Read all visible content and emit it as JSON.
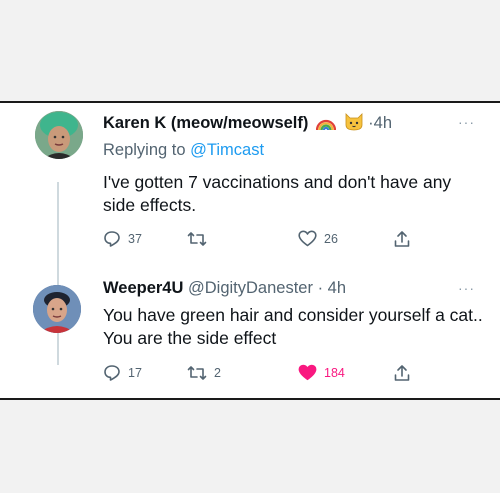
{
  "tweets": [
    {
      "author_name": "Karen K (meow/meowself)",
      "separator": "·",
      "time": "4h",
      "more": "···",
      "replying_prefix": "Replying to",
      "replying_handle": "@Timcast",
      "text": "I've gotten 7 vaccinations and don't have any side effects.",
      "stats": {
        "replies": "37",
        "retweets": "",
        "likes": "26"
      },
      "liked": false,
      "emojis": [
        "rainbow-icon",
        "cat-face-icon"
      ]
    },
    {
      "author_name": "Weeper4U",
      "handle": "@DigityDanester",
      "separator": "·",
      "time": "4h",
      "more": "···",
      "text": "You have green hair and consider yourself a cat.. You are the side effect",
      "stats": {
        "replies": "17",
        "retweets": "2",
        "likes": "184"
      },
      "liked": true
    }
  ],
  "colors": {
    "link": "#1d9bf0",
    "muted": "#536471",
    "like_active": "#f91880",
    "thread_line": "#cfd9de"
  }
}
